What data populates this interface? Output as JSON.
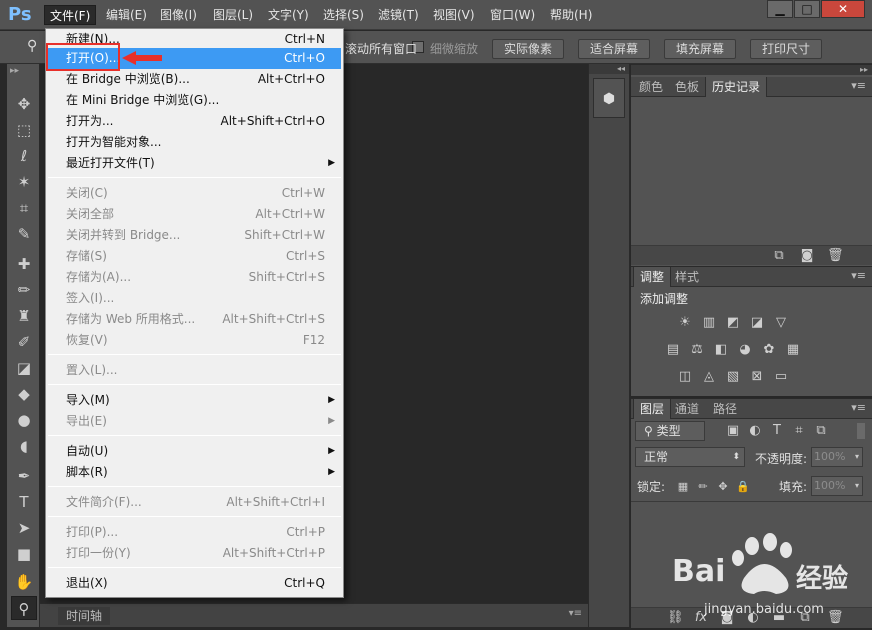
{
  "app": {
    "logo": "Ps"
  },
  "menubar": {
    "items": [
      "文件(F)",
      "编辑(E)",
      "图像(I)",
      "图层(L)",
      "文字(Y)",
      "选择(S)",
      "滤镜(T)",
      "视图(V)",
      "窗口(W)",
      "帮助(H)"
    ],
    "window_buttons": [
      "▁",
      "□",
      "✕"
    ]
  },
  "options_bar": {
    "scroll_all_label": "滚动所有窗口",
    "fine_zoom_label": "细微缩放",
    "buttons": [
      "实际像素",
      "适合屏幕",
      "填充屏幕",
      "打印尺寸"
    ]
  },
  "file_menu": {
    "items": [
      {
        "label": "新建(N)...",
        "shortcut": "Ctrl+N",
        "enabled": true
      },
      {
        "label": "打开(O)...",
        "shortcut": "Ctrl+O",
        "enabled": true,
        "highlighted": true
      },
      {
        "label": "在 Bridge 中浏览(B)...",
        "shortcut": "Alt+Ctrl+O",
        "enabled": true
      },
      {
        "label": "在 Mini Bridge 中浏览(G)...",
        "shortcut": "",
        "enabled": true
      },
      {
        "label": "打开为...",
        "shortcut": "Alt+Shift+Ctrl+O",
        "enabled": true
      },
      {
        "label": "打开为智能对象...",
        "shortcut": "",
        "enabled": true
      },
      {
        "label": "最近打开文件(T)",
        "shortcut": "",
        "enabled": true,
        "submenu": true
      },
      {
        "label": "关闭(C)",
        "shortcut": "Ctrl+W",
        "enabled": false
      },
      {
        "label": "关闭全部",
        "shortcut": "Alt+Ctrl+W",
        "enabled": false
      },
      {
        "label": "关闭并转到 Bridge...",
        "shortcut": "Shift+Ctrl+W",
        "enabled": false
      },
      {
        "label": "存储(S)",
        "shortcut": "Ctrl+S",
        "enabled": false
      },
      {
        "label": "存储为(A)...",
        "shortcut": "Shift+Ctrl+S",
        "enabled": false
      },
      {
        "label": "签入(I)...",
        "shortcut": "",
        "enabled": false
      },
      {
        "label": "存储为 Web 所用格式...",
        "shortcut": "Alt+Shift+Ctrl+S",
        "enabled": false
      },
      {
        "label": "恢复(V)",
        "shortcut": "F12",
        "enabled": false
      },
      {
        "label": "置入(L)...",
        "shortcut": "",
        "enabled": false
      },
      {
        "label": "导入(M)",
        "shortcut": "",
        "enabled": true,
        "submenu": true
      },
      {
        "label": "导出(E)",
        "shortcut": "",
        "enabled": false,
        "submenu": true
      },
      {
        "label": "自动(U)",
        "shortcut": "",
        "enabled": true,
        "submenu": true
      },
      {
        "label": "脚本(R)",
        "shortcut": "",
        "enabled": true,
        "submenu": true
      },
      {
        "label": "文件简介(F)...",
        "shortcut": "Alt+Shift+Ctrl+I",
        "enabled": false
      },
      {
        "label": "打印(P)...",
        "shortcut": "Ctrl+P",
        "enabled": false
      },
      {
        "label": "打印一份(Y)",
        "shortcut": "Alt+Shift+Ctrl+P",
        "enabled": false
      },
      {
        "label": "退出(X)",
        "shortcut": "Ctrl+Q",
        "enabled": true
      }
    ]
  },
  "status": {
    "timeline_tab": "时间轴"
  },
  "history_panel": {
    "tabs": [
      "颜色",
      "色板",
      "历史记录"
    ],
    "active": "历史记录"
  },
  "adjustments_panel": {
    "tabs": [
      "调整",
      "样式"
    ],
    "active": "调整",
    "heading": "添加调整"
  },
  "layers_panel": {
    "tabs": [
      "图层",
      "通道",
      "路径"
    ],
    "active": "图层",
    "filter_kind": "类型",
    "blend_mode": "正常",
    "opacity_label": "不透明度:",
    "opacity_value": "100%",
    "lock_label": "锁定:",
    "fill_label": "填充:",
    "fill_value": "100%"
  },
  "colors": {
    "highlight": "#3d9af3",
    "annotation_red": "#e8302a",
    "menubar": "#535353",
    "panel": "#535353"
  },
  "watermark": {
    "brand": "Bai",
    "brand2": "经验",
    "url": "jingyan.baidu.com"
  }
}
